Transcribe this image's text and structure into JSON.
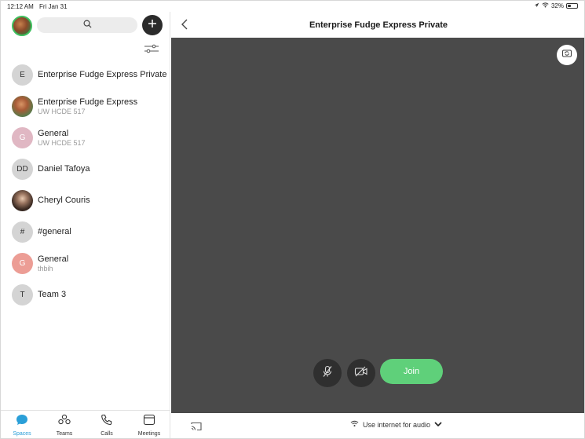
{
  "status_bar": {
    "time": "12:12 AM",
    "date": "Fri Jan 31",
    "battery": "32%",
    "battery_level": 0.32
  },
  "sidebar": {
    "search_icon": "search-icon",
    "add_icon": "plus-icon",
    "filter_icon": "filter-sliders-icon",
    "spaces": [
      {
        "avatar_text": "E",
        "avatar_style": "grey",
        "title": "Enterprise Fudge Express Private",
        "subtitle": ""
      },
      {
        "avatar_text": "",
        "avatar_style": "photo1",
        "title": "Enterprise Fudge Express",
        "subtitle": "UW HCDE 517"
      },
      {
        "avatar_text": "G",
        "avatar_style": "pink",
        "title": "General",
        "subtitle": "UW HCDE 517"
      },
      {
        "avatar_text": "DD",
        "avatar_style": "grey",
        "title": "Daniel Tafoya",
        "subtitle": ""
      },
      {
        "avatar_text": "",
        "avatar_style": "photo2",
        "title": "Cheryl Couris",
        "subtitle": ""
      },
      {
        "avatar_text": "#",
        "avatar_style": "grey",
        "title": "#general",
        "subtitle": ""
      },
      {
        "avatar_text": "G",
        "avatar_style": "red",
        "title": "General",
        "subtitle": "thbih"
      },
      {
        "avatar_text": "T",
        "avatar_style": "grey",
        "title": "Team 3",
        "subtitle": ""
      }
    ]
  },
  "tabs": [
    {
      "label": "Spaces",
      "icon": "chat-bubble-icon",
      "active": true
    },
    {
      "label": "Teams",
      "icon": "teams-icon",
      "active": false
    },
    {
      "label": "Calls",
      "icon": "phone-icon",
      "active": false
    },
    {
      "label": "Meetings",
      "icon": "calendar-icon",
      "active": false
    }
  ],
  "main": {
    "title": "Enterprise Fudge Express Private",
    "join_label": "Join",
    "audio_option": "Use internet for audio"
  },
  "colors": {
    "accent": "#2a9fd8",
    "join_green": "#5fd07a",
    "video_bg": "#4a4a4a",
    "presence_green": "#3fbf5f"
  }
}
